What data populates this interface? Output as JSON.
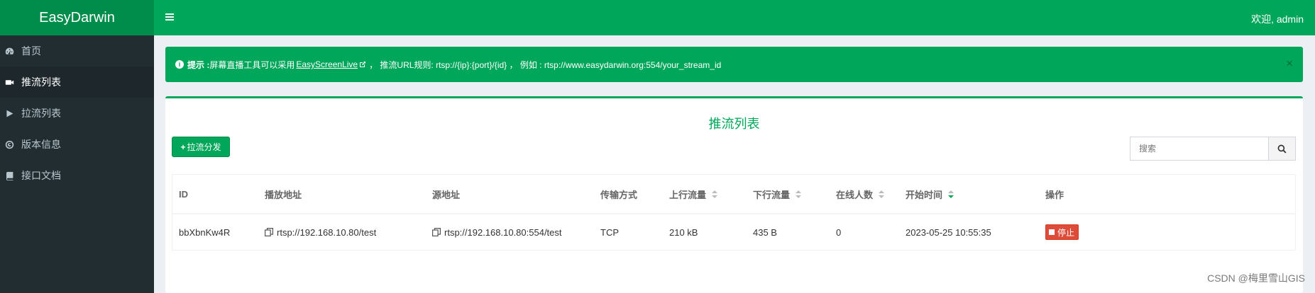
{
  "app": {
    "logo": "EasyDarwin",
    "welcome": "欢迎, admin"
  },
  "sidebar": {
    "items": [
      {
        "label": "首页",
        "icon": "dashboard-icon",
        "active": false
      },
      {
        "label": "推流列表",
        "icon": "video-camera-icon",
        "active": true
      },
      {
        "label": "拉流列表",
        "icon": "play-icon",
        "active": false
      },
      {
        "label": "版本信息",
        "icon": "copyright-icon",
        "active": false
      },
      {
        "label": "接口文档",
        "icon": "book-icon",
        "active": false
      }
    ]
  },
  "alert": {
    "prefix": "提示 :",
    "text1": " 屏幕直播工具可以采用",
    "link": "EasyScreenLive",
    "text2": "， 推流URL规则: rtsp://{ip}:{port}/{id} ， 例如 : rtsp://www.easydarwin.org:554/your_stream_id",
    "close": "×"
  },
  "box": {
    "title": "推流列表",
    "pull_button": "拉流分发",
    "search_placeholder": "搜索"
  },
  "table": {
    "headers": [
      "ID",
      "播放地址",
      "源地址",
      "传输方式",
      "上行流量",
      "下行流量",
      "在线人数",
      "开始时间",
      "操作"
    ],
    "rows": [
      {
        "id": "bbXbnKw4R",
        "play_url": "rtsp://192.168.10.80/test",
        "source_url": "rtsp://192.168.10.80:554/test",
        "transport": "TCP",
        "up": "210 kB",
        "down": "435 B",
        "online": "0",
        "start_time": "2023-05-25 10:55:35",
        "action": "停止"
      }
    ]
  },
  "colors": {
    "brand": "#00a65a",
    "brand_dark": "#008d4c",
    "sidebar": "#222d32",
    "danger": "#dd4b39"
  },
  "watermark": "CSDN @梅里雪山GIS"
}
